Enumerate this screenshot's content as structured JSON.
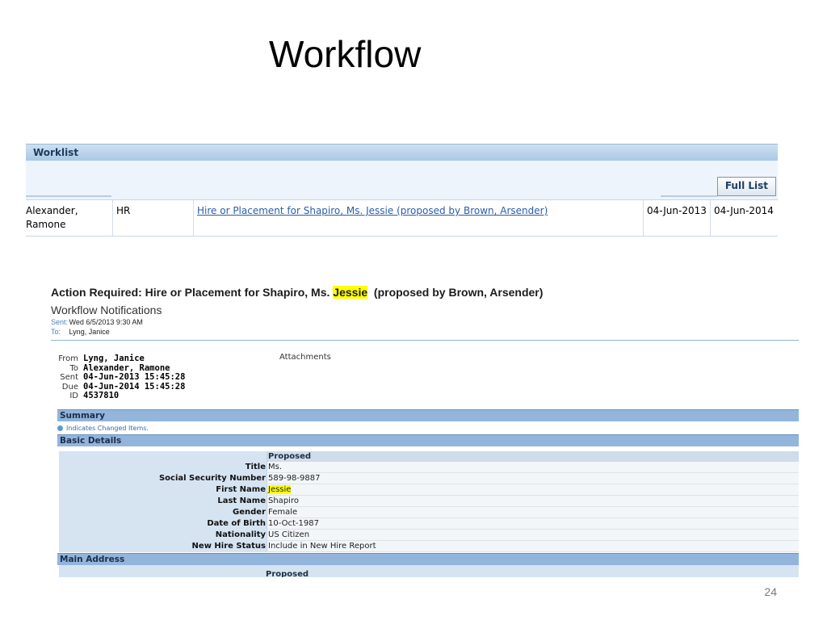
{
  "slide": {
    "title": "Workflow",
    "page_number": "24"
  },
  "worklist": {
    "header": "Worklist",
    "full_list_label": "Full List",
    "row": {
      "from": "Alexander, Ramone",
      "type": "HR",
      "subject": "Hire or Placement for Shapiro, Ms. Jessie (proposed by Brown, Arsender)",
      "sent": "04-Jun-2013",
      "due": "04-Jun-2014"
    }
  },
  "notification": {
    "title_prefix": "Action Required: Hire or Placement for Shapiro, Ms.",
    "title_highlight": "Jessie",
    "title_suffix": "(proposed by Brown, Arsender)",
    "subtitle": "Workflow Notifications",
    "sent_label": "Sent:",
    "sent_value": "Wed 6/5/2013 9:30 AM",
    "to_label": "To:",
    "to_value": "Lyng, Janice",
    "fields": {
      "from_label": "From",
      "from_value": "Lyng, Janice",
      "to_label": "To",
      "to_value": "Alexander, Ramone",
      "sent_label": "Sent",
      "sent_value": "04-Jun-2013 15:45:28",
      "due_label": "Due",
      "due_value": "04-Jun-2014 15:45:28",
      "id_label": "ID",
      "id_value": "4537810"
    },
    "attachments_label": "Attachments",
    "summary_label": "Summary",
    "indicates_text": "Indicates Changed Items.",
    "basic_details_label": "Basic Details",
    "proposed_label": "Proposed",
    "details": [
      {
        "label": "Title",
        "value": "Ms."
      },
      {
        "label": "Social Security Number",
        "value": "589-98-9887"
      },
      {
        "label": "First Name",
        "value": "Jessie"
      },
      {
        "label": "Last Name",
        "value": "Shapiro"
      },
      {
        "label": "Gender",
        "value": "Female"
      },
      {
        "label": "Date of Birth",
        "value": "10-Oct-1987"
      },
      {
        "label": "Nationality",
        "value": "US Citizen"
      },
      {
        "label": "New Hire Status",
        "value": "Include in New Hire Report"
      }
    ],
    "main_address_label": "Main Address",
    "main_address_proposed": "Proposed"
  },
  "colors": {
    "link": "#2a5ea8",
    "section_bar": "#93b4db",
    "highlight": "#ffff00"
  }
}
